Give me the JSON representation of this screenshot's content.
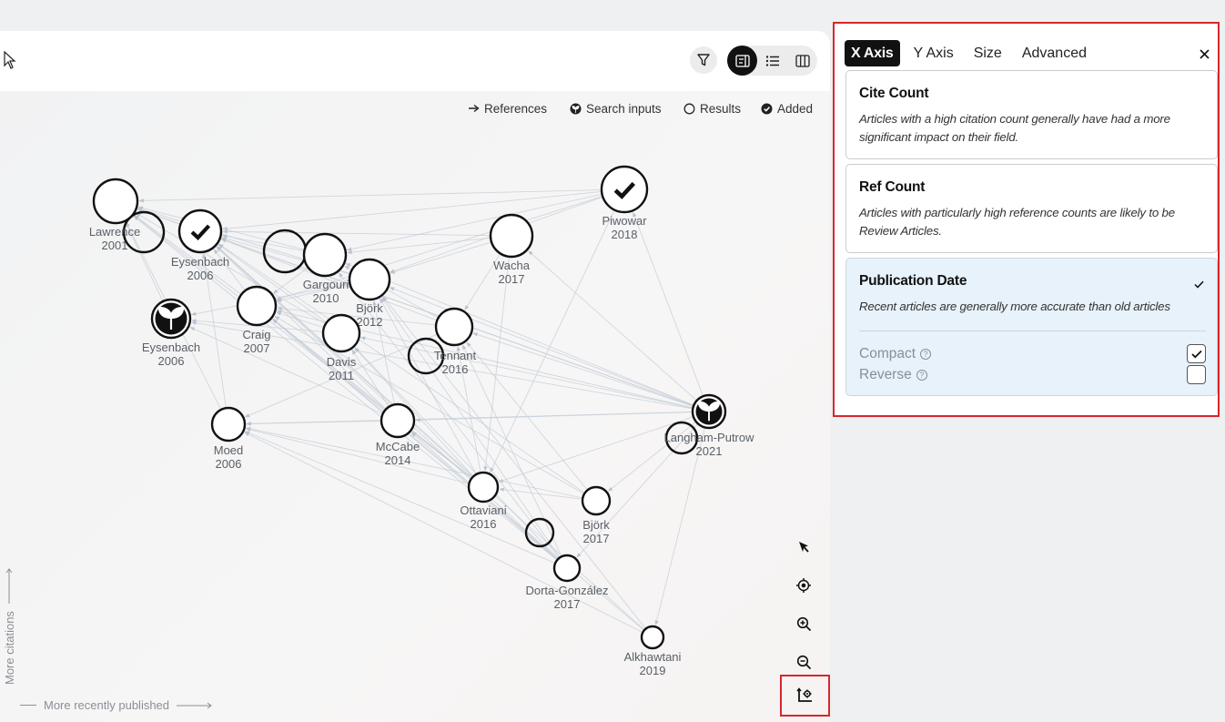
{
  "legend": {
    "references": "References",
    "search_inputs": "Search inputs",
    "results": "Results",
    "added": "Added"
  },
  "axis_hints": {
    "x": "More recently published",
    "y": "More citations"
  },
  "panel": {
    "tabs": [
      "X Axis",
      "Y Axis",
      "Size",
      "Advanced"
    ],
    "active_tab": "X Axis",
    "close_label": "×",
    "options": [
      {
        "title": "Cite Count",
        "description": "Articles with a high citation count generally have had a more significant impact on their field.",
        "selected": false
      },
      {
        "title": "Ref Count",
        "description": "Articles with particularly high reference counts are likely to be Review Articles.",
        "selected": false
      },
      {
        "title": "Publication Date",
        "description": "Recent articles are generally more accurate than old articles",
        "selected": true,
        "check_mark": "✓",
        "sub_options": [
          {
            "label": "Compact",
            "checked": true
          },
          {
            "label": "Reverse",
            "checked": false
          }
        ]
      }
    ]
  },
  "graph": {
    "nodes": [
      {
        "id": "lawrence",
        "name": "Lawrence",
        "year": "2001",
        "kind": "result"
      },
      {
        "id": "eysenbach-a",
        "name": "Eysenbach",
        "year": "2006",
        "kind": "added"
      },
      {
        "id": "eysenbach-b",
        "name": "Eysenbach",
        "year": "2006",
        "kind": "seed"
      },
      {
        "id": "gargouri",
        "name": "Gargouri",
        "year": "2010",
        "kind": "result"
      },
      {
        "id": "bjork12",
        "name": "Björk",
        "year": "2012",
        "kind": "result"
      },
      {
        "id": "craig",
        "name": "Craig",
        "year": "2007",
        "kind": "result"
      },
      {
        "id": "davis",
        "name": "Davis",
        "year": "2011",
        "kind": "result"
      },
      {
        "id": "wacha",
        "name": "Wacha",
        "year": "2017",
        "kind": "result"
      },
      {
        "id": "piwowar",
        "name": "Piwowar",
        "year": "2018",
        "kind": "added"
      },
      {
        "id": "tennant",
        "name": "Tennant",
        "year": "2016",
        "kind": "result"
      },
      {
        "id": "moed",
        "name": "Moed",
        "year": "2006",
        "kind": "result"
      },
      {
        "id": "mccabe",
        "name": "McCabe",
        "year": "2014",
        "kind": "result"
      },
      {
        "id": "langham",
        "name": "Langham-Putrow",
        "year": "2021",
        "kind": "seed"
      },
      {
        "id": "ottaviani",
        "name": "Ottaviani",
        "year": "2016",
        "kind": "result"
      },
      {
        "id": "bjork17",
        "name": "Björk",
        "year": "2017",
        "kind": "result"
      },
      {
        "id": "dorta",
        "name": "Dorta-González",
        "year": "2017",
        "kind": "result"
      },
      {
        "id": "alkhawtani",
        "name": "Alkhawtani",
        "year": "2019",
        "kind": "result"
      }
    ]
  },
  "toolbar": {
    "tools": [
      "select-arrow-icon",
      "locate-icon",
      "zoom-in-icon",
      "zoom-out-icon",
      "axis-settings-icon"
    ]
  }
}
